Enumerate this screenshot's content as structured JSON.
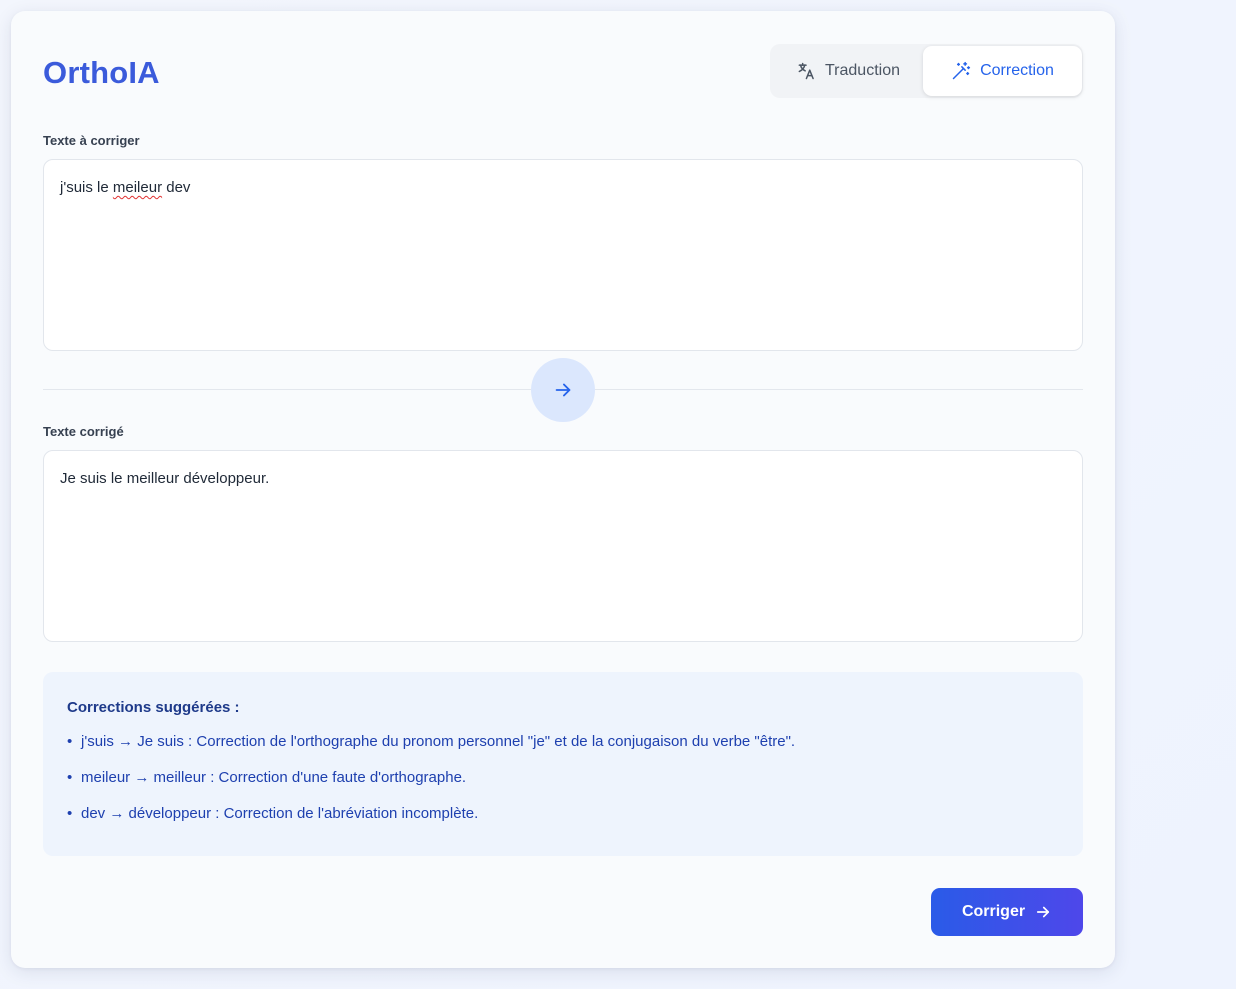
{
  "app": {
    "title": "OrthoIA"
  },
  "modes": {
    "translate_label": "Traduction",
    "correct_label": "Correction",
    "active": "Correction"
  },
  "input": {
    "label": "Texte à corriger",
    "value_parts": [
      "j'suis le ",
      "meileur",
      " dev"
    ],
    "misspelled_word": "meileur"
  },
  "output": {
    "label": "Texte corrigé",
    "value": "Je suis le meilleur développeur."
  },
  "suggestions": {
    "title": "Corrections suggérées :",
    "items": [
      "j'suis → Je suis : Correction de l'orthographe du pronom personnel \"je\" et de la conjugaison du verbe \"être\".",
      "meileur → meilleur : Correction d'une faute d'orthographe.",
      "dev → développeur : Correction de l'abréviation incomplète."
    ]
  },
  "actions": {
    "submit_label": "Corriger"
  },
  "colors": {
    "accent": "#2563eb",
    "brand": "#3b5bdb",
    "suggestion_bg": "#eef4fd",
    "suggestion_text": "#1e40af"
  },
  "icons": {
    "translate": "translate-icon",
    "correct": "magic-wand-icon",
    "swap": "arrow-right-icon",
    "submit": "arrow-right-icon"
  }
}
